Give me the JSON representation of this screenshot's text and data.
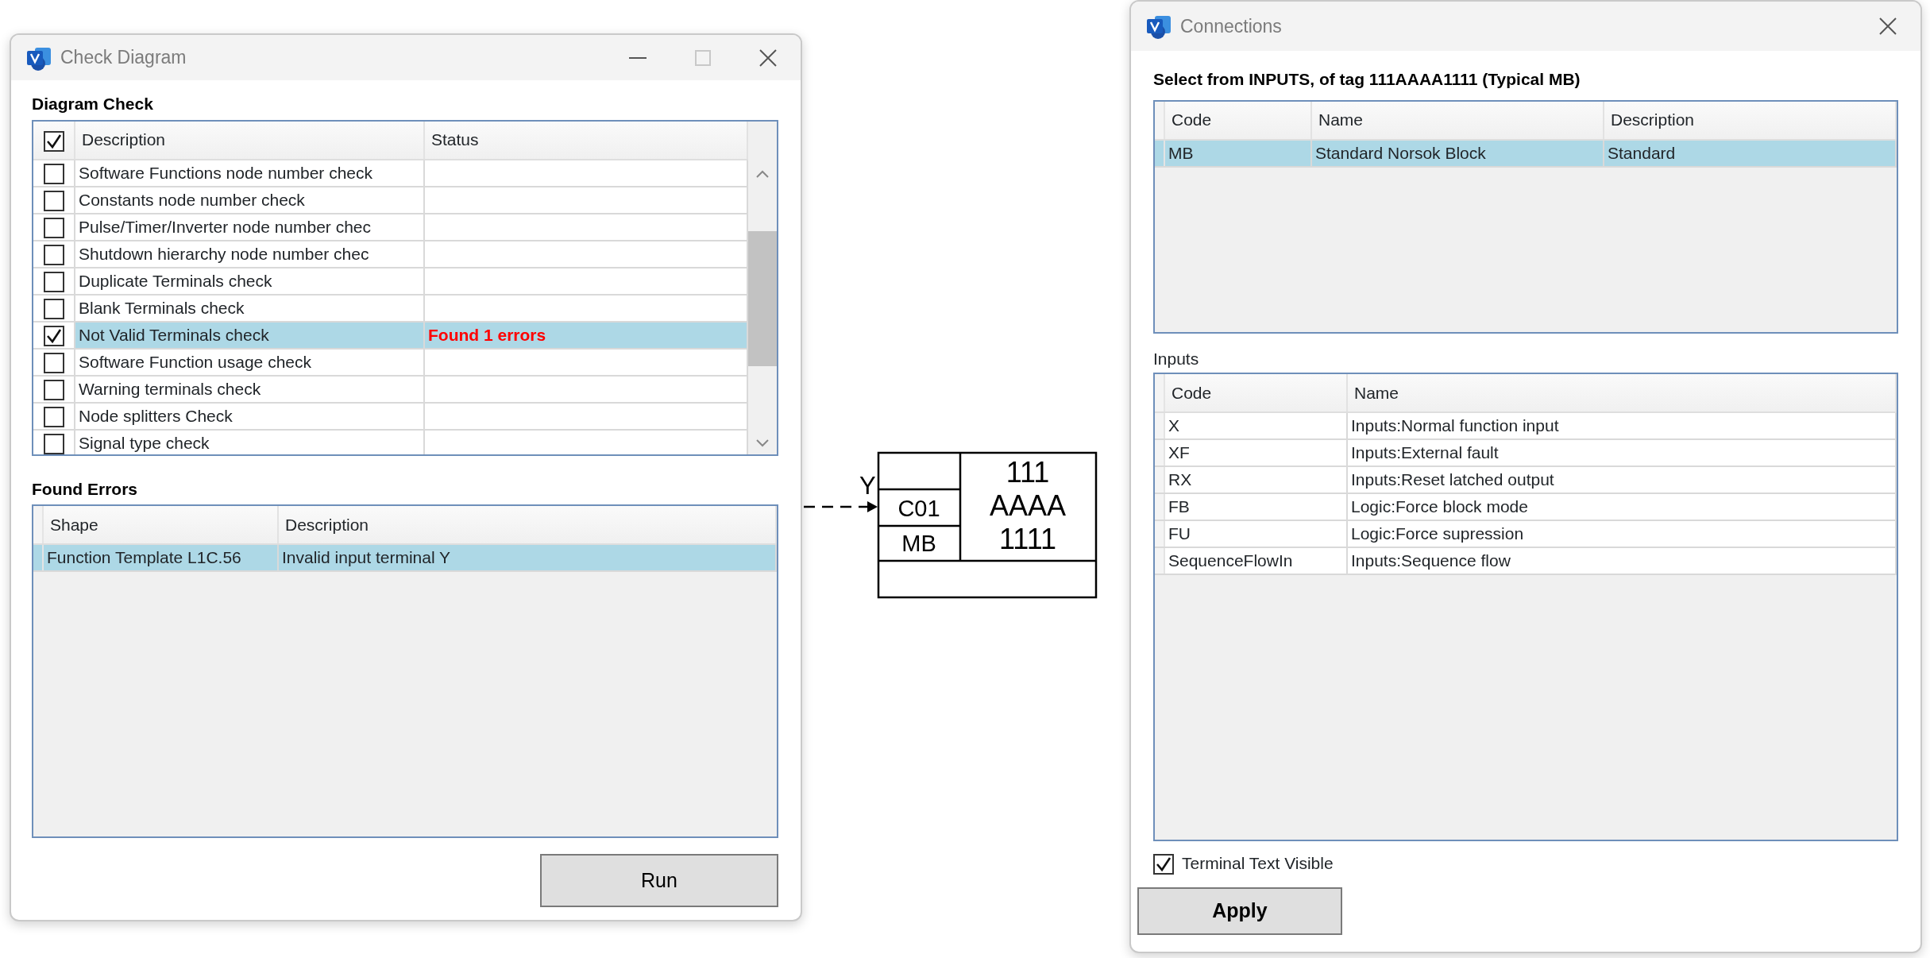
{
  "check_window": {
    "title": "Check Diagram",
    "diagram_check": {
      "heading": "Diagram Check",
      "header_checked": true,
      "columns": [
        "Description",
        "Status"
      ],
      "rows": [
        {
          "description": "Software Functions node number check",
          "checked": false,
          "selected": false
        },
        {
          "description": "Constants node number check",
          "checked": false,
          "selected": false
        },
        {
          "description": "Pulse/Timer/Inverter node number chec",
          "checked": false,
          "selected": false
        },
        {
          "description": "Shutdown hierarchy node number chec",
          "checked": false,
          "selected": false
        },
        {
          "description": "Duplicate Terminals check",
          "checked": false,
          "selected": false
        },
        {
          "description": "Blank Terminals check",
          "checked": false,
          "selected": false
        },
        {
          "description": "Not Valid Terminals check",
          "status": "Found 1 errors",
          "checked": true,
          "selected": true
        },
        {
          "description": "Software Function usage check",
          "checked": false,
          "selected": false
        },
        {
          "description": "Warning terminals check",
          "checked": false,
          "selected": false
        },
        {
          "description": "Node splitters Check",
          "checked": false,
          "selected": false
        },
        {
          "description": "Signal type check",
          "checked": false,
          "selected": false
        }
      ]
    },
    "found_errors": {
      "heading": "Found Errors",
      "columns": [
        "Shape",
        "Description"
      ],
      "rows": [
        {
          "shape": "Function Template L1C.56",
          "description": "Invalid input terminal Y",
          "selected": true
        }
      ]
    },
    "run_button": "Run"
  },
  "diagram": {
    "terminal": "Y",
    "cells": [
      "C01",
      "MB"
    ],
    "tag_lines": [
      "111",
      "AAAA",
      "1111"
    ]
  },
  "connections_window": {
    "title": "Connections",
    "heading": "Select from INPUTS, of tag 111AAAA1111 (Typical MB)",
    "typicals": {
      "columns": [
        "Code",
        "Name",
        "Description"
      ],
      "rows": [
        {
          "code": "MB",
          "name": "Standard Norsok Block",
          "description": "Standard",
          "selected": true
        }
      ]
    },
    "inputs": {
      "label": "Inputs",
      "columns": [
        "Code",
        "Name"
      ],
      "rows": [
        {
          "code": "X",
          "name": "Inputs:Normal function input",
          "selected": false
        },
        {
          "code": "XF",
          "name": "Inputs:External fault",
          "selected": false
        },
        {
          "code": "RX",
          "name": "Inputs:Reset latched output",
          "selected": false
        },
        {
          "code": "FB",
          "name": "Logic:Force block mode",
          "selected": false
        },
        {
          "code": "FU",
          "name": "Logic:Force supression",
          "selected": false
        },
        {
          "code": "SequenceFlowIn",
          "name": "Inputs:Sequence flow",
          "selected": false
        }
      ]
    },
    "terminal_text_visible": {
      "label": "Terminal Text Visible",
      "checked": true
    },
    "apply_button": "Apply"
  }
}
